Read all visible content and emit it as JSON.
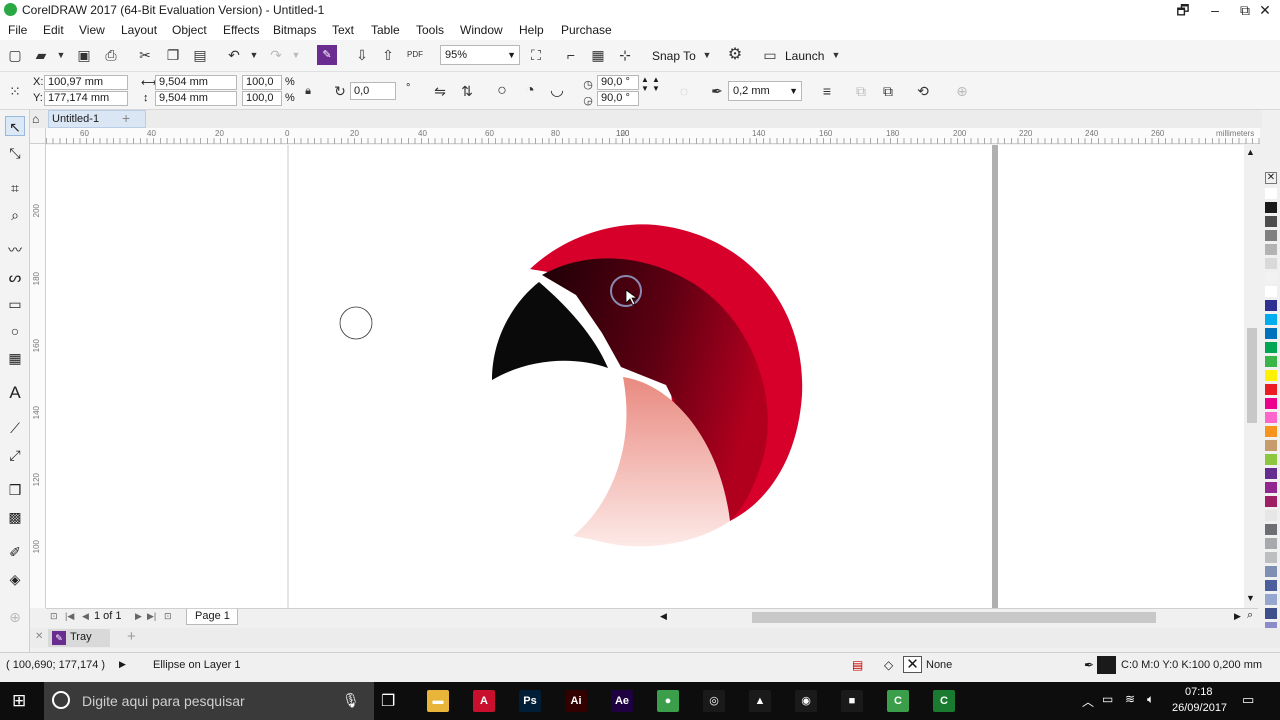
{
  "window": {
    "title": "CorelDRAW 2017 (64-Bit Evaluation Version) - Untitled-1",
    "controls": [
      "🗗",
      "–",
      "⧉",
      "✕"
    ]
  },
  "menu": [
    "File",
    "Edit",
    "View",
    "Layout",
    "Object",
    "Effects",
    "Bitmaps",
    "Text",
    "Table",
    "Tools",
    "Window",
    "Help",
    "Purchase"
  ],
  "standard_toolbar": {
    "zoom_value": "95%",
    "snap_to": "Snap To",
    "launch": "Launch"
  },
  "property_bar": {
    "x_label": "X:",
    "x_value": "100,97 mm",
    "y_label": "Y:",
    "y_value": "177,174 mm",
    "width_value": "9,504 mm",
    "height_value": "9,504 mm",
    "scale_x": "100,0",
    "scale_y": "100,0",
    "percent": "%",
    "rotation": "0,0",
    "deg": "°",
    "start_angle": "90,0 °",
    "end_angle": "90,0 °",
    "outline_width": "0,2 mm"
  },
  "doc_tab": {
    "name": "Untitled-1",
    "add": "+"
  },
  "rulers": {
    "h_ticks": [
      "60",
      "40",
      "20",
      "0",
      "20",
      "40",
      "60",
      "80",
      "100",
      "120",
      "140",
      "160",
      "180",
      "200",
      "220",
      "240",
      "260"
    ],
    "units": "millimeters",
    "v_ticks": [
      "200",
      "180",
      "160",
      "140",
      "120",
      "100"
    ]
  },
  "page_nav": {
    "page_of": "1  of  1",
    "page_tab": "Page 1"
  },
  "tray": {
    "label": "Tray",
    "add": "+"
  },
  "status": {
    "coords": "( 100,690; 177,174 )",
    "object": "Ellipse on Layer 1",
    "fill": "None",
    "outline": "C:0 M:0 Y:0 K:100  0,200 mm"
  },
  "taskbar": {
    "search_placeholder": "Digite aqui para pesquisar",
    "time": "07:18",
    "date": "26/09/2017",
    "apps": [
      {
        "name": "file-explorer",
        "glyph": "▬",
        "color": "#e8b53a"
      },
      {
        "name": "acrobat",
        "glyph": "A",
        "color": "#c8102e"
      },
      {
        "name": "photoshop",
        "glyph": "Ps",
        "color": "#001e36"
      },
      {
        "name": "illustrator",
        "glyph": "Ai",
        "color": "#330000"
      },
      {
        "name": "after-effects",
        "glyph": "Ae",
        "color": "#1f0040"
      },
      {
        "name": "coreldraw",
        "glyph": "●",
        "color": "#3a9e4a"
      },
      {
        "name": "blender",
        "glyph": "◎",
        "color": "#1a1a1a"
      },
      {
        "name": "vlc",
        "glyph": "▲",
        "color": "#1a1a1a"
      },
      {
        "name": "chrome",
        "glyph": "◉",
        "color": "#1a1a1a"
      },
      {
        "name": "sticky-notes",
        "glyph": "■",
        "color": "#1a1a1a"
      },
      {
        "name": "corel-capture",
        "glyph": "C",
        "color": "#3a9e4a"
      },
      {
        "name": "corel-app",
        "glyph": "C",
        "color": "#1a7a30"
      }
    ]
  },
  "palette": [
    "#ffffff",
    "#1a1a1a",
    "#4d4d4d",
    "#808080",
    "#b3b3b3",
    "#d9d9d9",
    "#f2f2f2",
    "#ffffff",
    "#2e3192",
    "#00aeef",
    "#0072bc",
    "#00a651",
    "#39b54a",
    "#fff200",
    "#ed1c24",
    "#ec008c",
    "#ff66cc",
    "#f7941d",
    "#c69c6d",
    "#8dc63f",
    "#662d91",
    "#92278f",
    "#9e1f63",
    "#e6e6e6",
    "#6d6e71",
    "#a7a9ac",
    "#bcbec0",
    "#7f8fb3",
    "#4b5f9c",
    "#96a7cf",
    "#3f4f8c",
    "#8c8cc8"
  ],
  "colors": {
    "accent_red": "#d7002a",
    "dark_red": "#2a0008",
    "pink": "#eb9a90"
  }
}
